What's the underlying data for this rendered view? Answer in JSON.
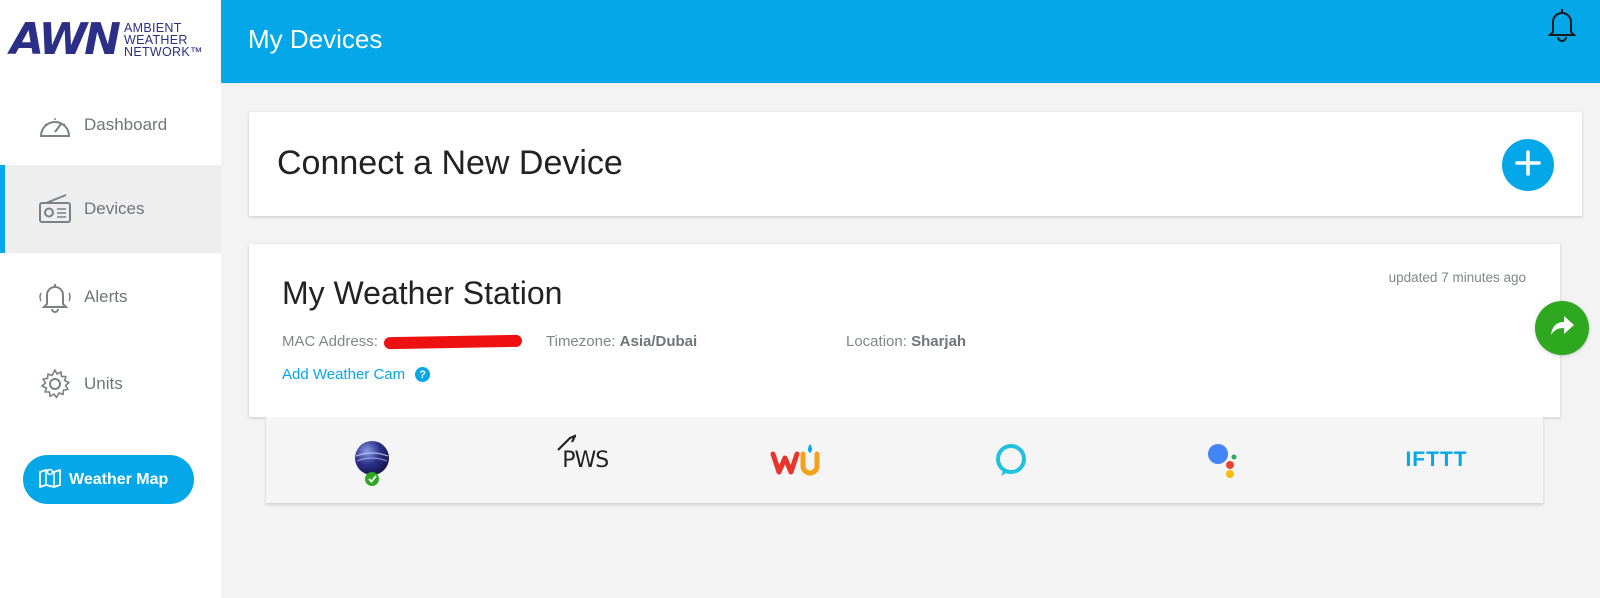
{
  "brand": {
    "mark": "AWN",
    "line1": "AMBIENT",
    "line2": "WEATHER",
    "line3": "NETWORK™"
  },
  "sidebar": {
    "items": [
      {
        "label": "Dashboard",
        "icon": "gauge-icon"
      },
      {
        "label": "Devices",
        "icon": "radio-icon",
        "active": true
      },
      {
        "label": "Alerts",
        "icon": "bell-icon"
      },
      {
        "label": "Units",
        "icon": "gear-icon"
      }
    ],
    "weather_map_label": "Weather Map"
  },
  "header": {
    "title": "My Devices"
  },
  "connect": {
    "title": "Connect a New Device"
  },
  "station": {
    "name": "My Weather Station",
    "updated": "updated 7 minutes ago",
    "mac_label": "MAC Address:",
    "timezone_label": "Timezone:",
    "timezone_value": "Asia/Dubai",
    "location_label": "Location:",
    "location_value": "Sharjah",
    "add_cam_label": "Add Weather Cam",
    "help_glyph": "?"
  },
  "integrations": {
    "pws_label": "PWS",
    "wu_label": "wu",
    "ifttt_label": "IFTTT"
  },
  "colors": {
    "accent": "#04a8e8",
    "brand": "#2b2f86",
    "success": "#2ea81f",
    "redaction": "#ee1111"
  }
}
